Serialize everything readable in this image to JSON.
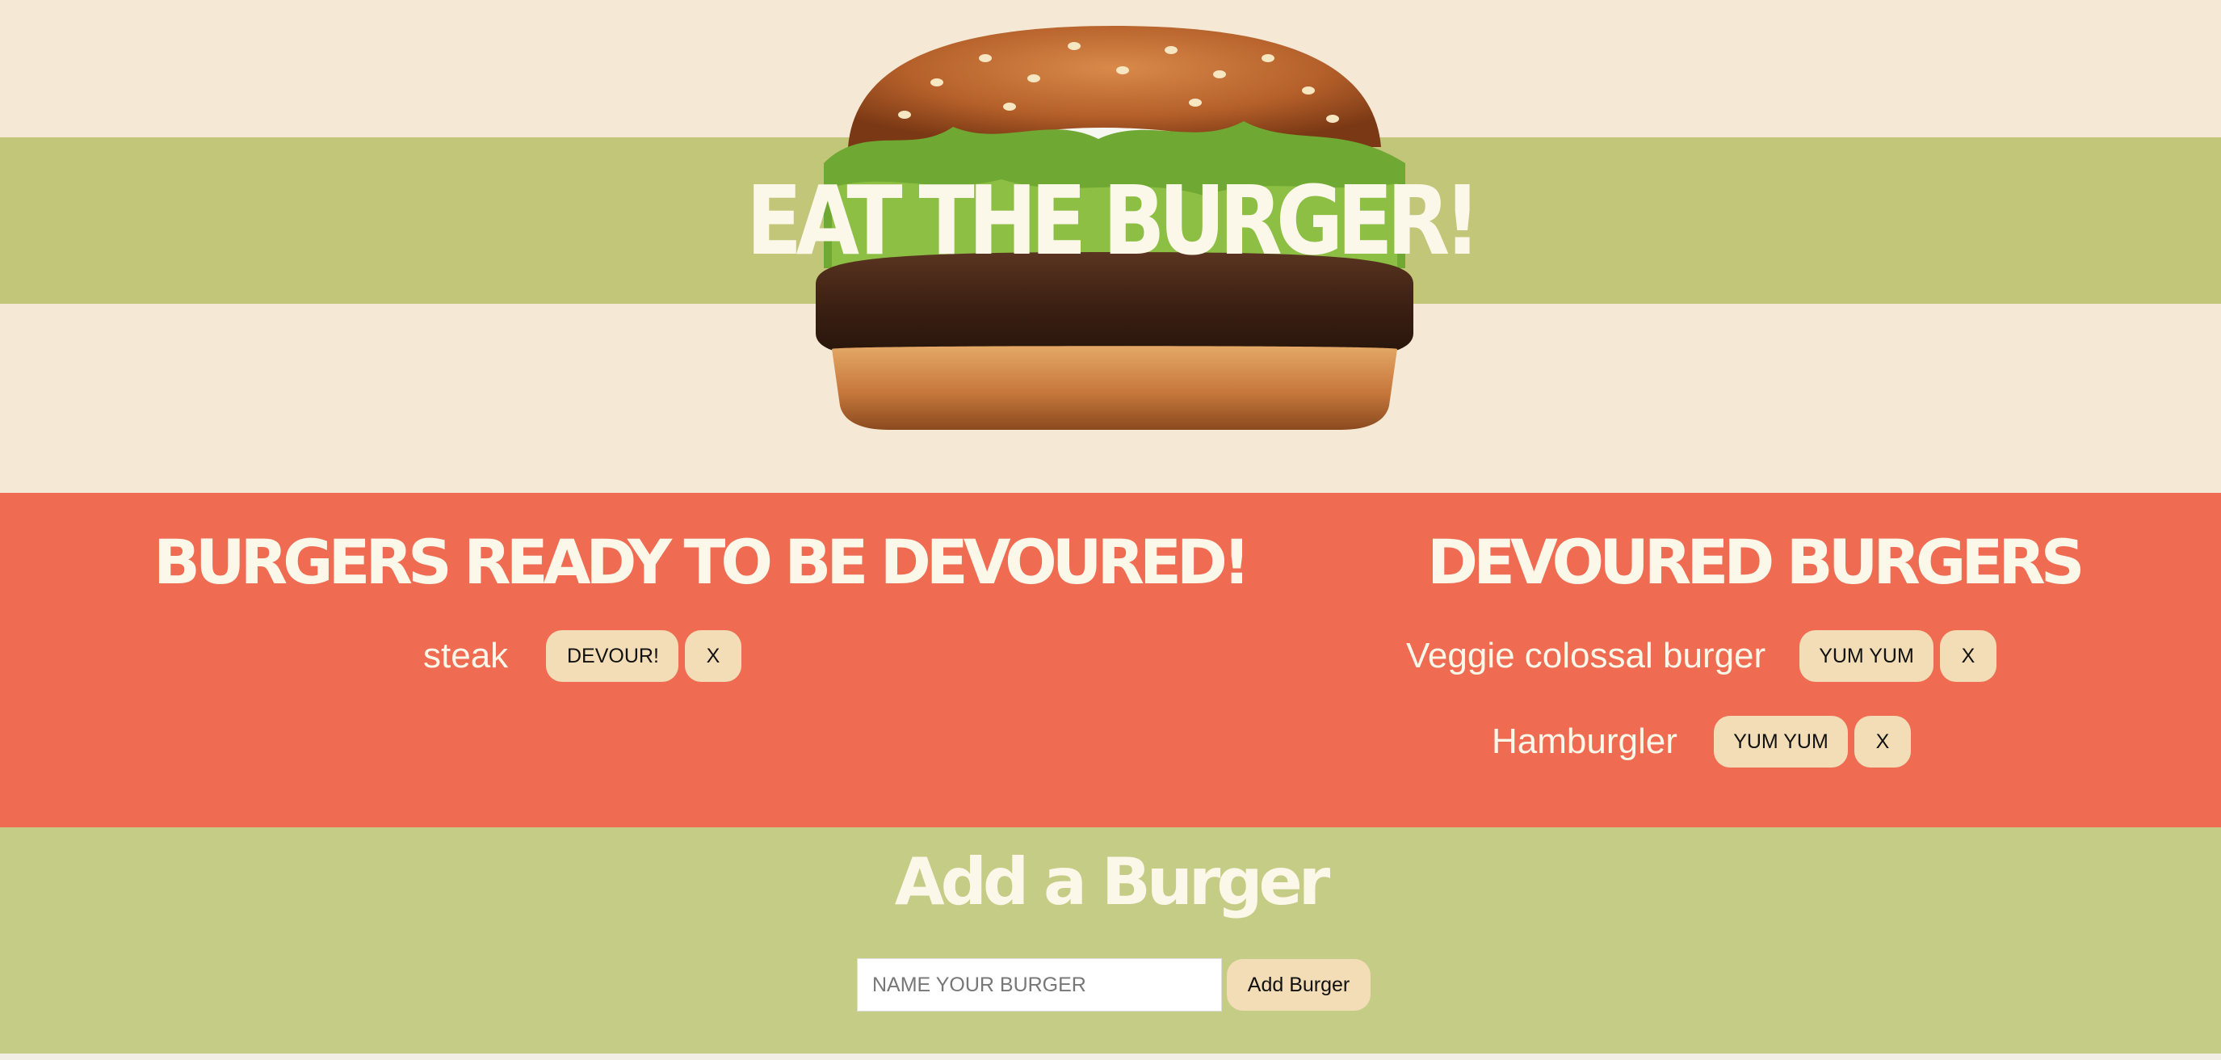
{
  "hero": {
    "title": "EAT THE BURGER!",
    "image": "burger-image"
  },
  "ready": {
    "title": "BURGERS READY TO BE DEVOURED!",
    "items": [
      {
        "name": "steak",
        "action_label": "DEVOUR!",
        "delete_label": "X"
      }
    ]
  },
  "devoured": {
    "title": "DEVOURED BURGERS",
    "items": [
      {
        "name": "Veggie colossal burger",
        "action_label": "YUM YUM",
        "delete_label": "X"
      },
      {
        "name": "Hamburgler",
        "action_label": "YUM YUM",
        "delete_label": "X"
      }
    ]
  },
  "add": {
    "title": "Add a Burger",
    "placeholder": "NAME YOUR BURGER",
    "value": "",
    "button_label": "Add Burger"
  },
  "colors": {
    "cream": "#f5e9d5",
    "olive_band": "#c1c679",
    "coral": "#ef6b52",
    "form_green": "#c5cc86",
    "button": "#f3ddb7",
    "title_text": "#fbf7e9"
  }
}
